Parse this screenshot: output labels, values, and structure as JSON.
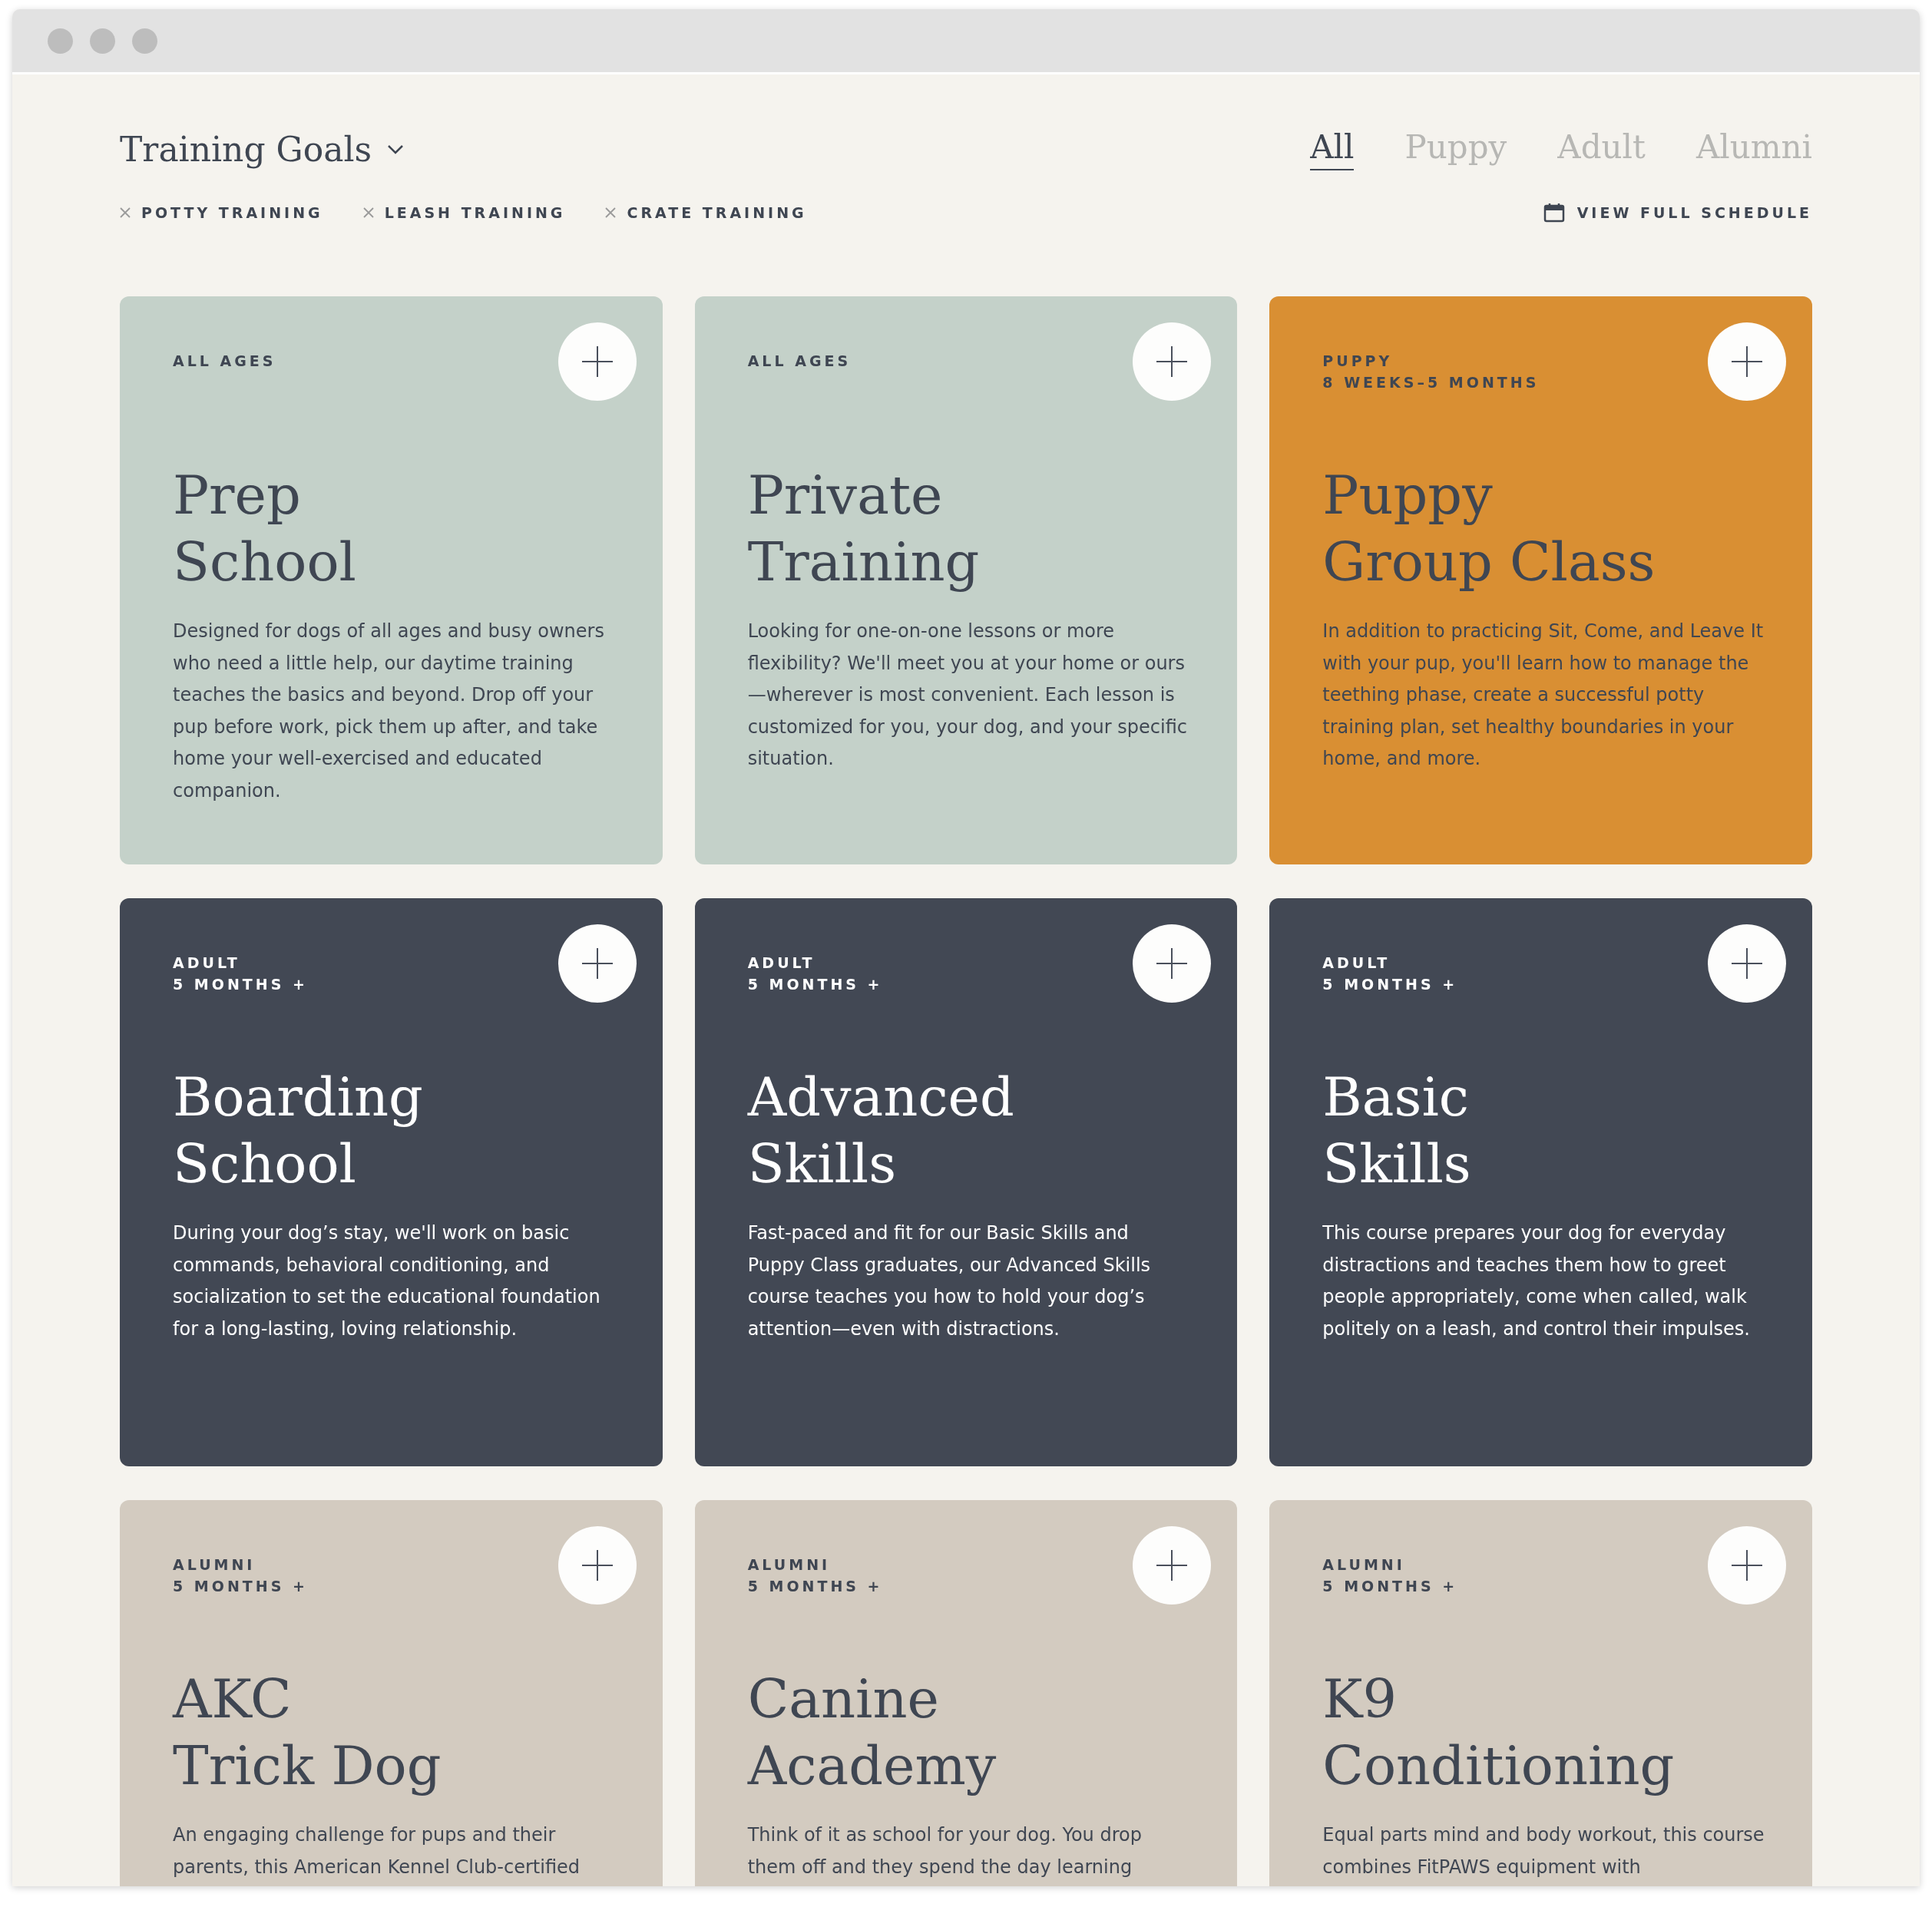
{
  "header": {
    "title": "Training Goals",
    "tabs": [
      {
        "label": "All",
        "selected": true
      },
      {
        "label": "Puppy",
        "selected": false
      },
      {
        "label": "Adult",
        "selected": false
      },
      {
        "label": "Alumni",
        "selected": false
      }
    ],
    "filters": [
      "POTTY TRAINING",
      "LEASH TRAINING",
      "CRATE TRAINING"
    ],
    "schedule_link": "VIEW FULL SCHEDULE"
  },
  "cards": [
    {
      "color": "#c4d1c9",
      "tags": [
        "ALL AGES"
      ],
      "title": [
        "Prep",
        "School"
      ],
      "description": "Designed for dogs of all ages and busy owners who need a little help, our daytime training teaches the basics and beyond. Drop off your pup before work, pick them up after, and take home your well-exercised and educated companion."
    },
    {
      "color": "#c4d1c9",
      "tags": [
        "ALL AGES"
      ],
      "title": [
        "Private",
        "Training"
      ],
      "description": "Looking for one-on-one lessons or more flexibility? We'll meet you at your home or ours—wherever is most convenient. Each lesson is customized for you, your dog, and your specific situation."
    },
    {
      "color": "#d98f33",
      "tags": [
        "PUPPY",
        "8 WEEKS–5 MONTHS"
      ],
      "title": [
        "Puppy",
        "Group Class"
      ],
      "description": "In addition to practicing Sit, Come, and Leave It with your pup, you'll learn how to manage the teething phase, create a successful potty training plan, set healthy boundaries in your home, and more."
    },
    {
      "color": "#424854",
      "tags": [
        "ADULT",
        "5 MONTHS +"
      ],
      "title": [
        "Boarding",
        "School"
      ],
      "description": "During your dog’s stay, we'll work on basic commands, behavioral conditioning, and socialization to set the educational foundation for a long-lasting, loving relationship."
    },
    {
      "color": "#424854",
      "tags": [
        "ADULT",
        "5 MONTHS +"
      ],
      "title": [
        "Advanced",
        "Skills"
      ],
      "description": "Fast-paced and fit for our Basic Skills and Puppy Class graduates, our Advanced Skills course teaches you how to hold your dog’s attention—even with distractions."
    },
    {
      "color": "#424854",
      "tags": [
        "ADULT",
        "5 MONTHS +"
      ],
      "title": [
        "Basic",
        "Skills"
      ],
      "description": "This course prepares your dog for everyday distractions and teaches them how to greet people appropriately, come when called, walk politely on a leash, and control their impulses."
    },
    {
      "color": "#d3cbc0",
      "tags": [
        "ALUMNI",
        "5 MONTHS +"
      ],
      "title": [
        "AKC",
        "Trick Dog"
      ],
      "description": "An engaging challenge for pups and their parents, this American Kennel Club-certified"
    },
    {
      "color": "#d3cbc0",
      "tags": [
        "ALUMNI",
        "5 MONTHS +"
      ],
      "title": [
        "Canine",
        "Academy"
      ],
      "description": "Think of it as school for your dog. You drop them off and they spend the day learning"
    },
    {
      "color": "#d3cbc0",
      "tags": [
        "ALUMNI",
        "5 MONTHS +"
      ],
      "title": [
        "K9",
        "Conditioning"
      ],
      "description": "Equal parts mind and body workout, this course combines FitPAWS equipment with"
    }
  ]
}
